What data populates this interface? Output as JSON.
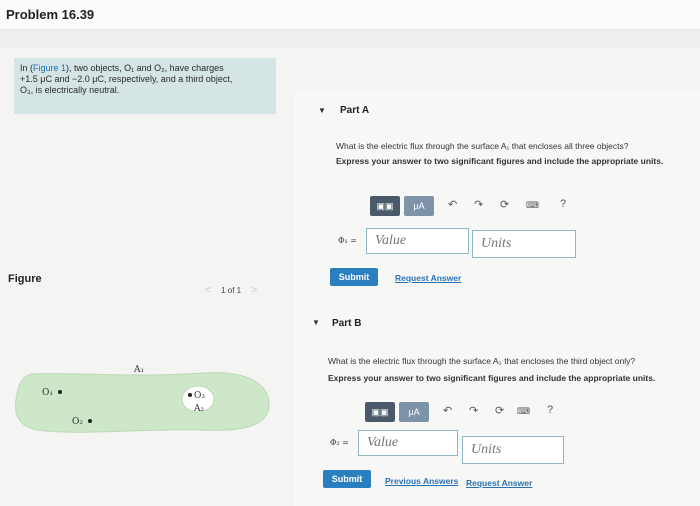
{
  "header": {
    "title": "Problem 16.39"
  },
  "intro": {
    "prefix": "In (",
    "link": "Figure 1",
    "line1_rest": "), two objects, O₁ and O₂, have charges",
    "line2": "+1.5 μC and −2.0 μC, respectively, and a third object,",
    "line3": "O₃, is electrically neutral."
  },
  "figure_panel": {
    "label": "Figure",
    "pager": "1 of 1",
    "surface_a1": "A₁",
    "surface_a2": "A₂",
    "object1": "O₁",
    "object2": "O₂",
    "object3": "O₃"
  },
  "part_a": {
    "title": "Part A",
    "question": "What is the electric flux through the surface A₁ that encloses all three objects?",
    "instruction": "Express your answer to two significant figures and include the appropriate units.",
    "var_label": "Φ₁ =",
    "value_placeholder": "Value",
    "units_placeholder": "Units",
    "submit": "Submit",
    "request_answer": "Request Answer"
  },
  "part_b": {
    "title": "Part B",
    "question": "What is the electric flux through the surface A₂ that encloses the third object only?",
    "instruction": "Express your answer to two significant figures and include the appropriate units.",
    "var_label": "Φ₂ =",
    "value_placeholder": "Value",
    "units_placeholder": "Units",
    "submit": "Submit",
    "previous_answers": "Previous Answers",
    "request_answer": "Request Answer"
  },
  "toolbar": {
    "mu_a": "μA",
    "help": "?"
  },
  "icons": [
    "templates-icon",
    "mu-a-icon",
    "undo-icon",
    "redo-icon",
    "reset-icon",
    "keyboard-icon",
    "help-icon"
  ],
  "colors": {
    "accent": "#2a7fc0",
    "intro_bg": "#d5e4e4",
    "figure_fill": "#cfe7c9"
  }
}
